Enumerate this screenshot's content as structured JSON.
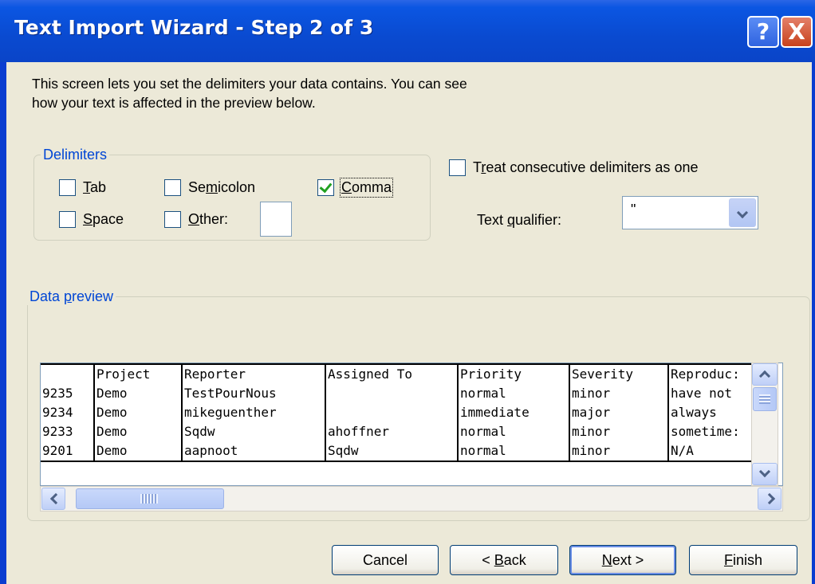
{
  "window": {
    "title": "Text Import Wizard - Step 2 of 3",
    "help_glyph": "?",
    "close_glyph": "X"
  },
  "description": {
    "line1": "This screen lets you set the delimiters your data contains.  You can see",
    "line2": "how your text is affected in the preview below."
  },
  "delimiters": {
    "legend": "Delimiters",
    "tab": {
      "label_pre": "",
      "label_ul": "T",
      "label_post": "ab",
      "checked": false
    },
    "semicolon": {
      "label_pre": "Se",
      "label_ul": "m",
      "label_post": "icolon",
      "checked": false
    },
    "comma": {
      "label_pre": "",
      "label_ul": "C",
      "label_post": "omma",
      "checked": true
    },
    "space": {
      "label_pre": "",
      "label_ul": "S",
      "label_post": "pace",
      "checked": false
    },
    "other": {
      "label_pre": "",
      "label_ul": "O",
      "label_post": "ther:",
      "checked": false,
      "value": ""
    }
  },
  "consecutive": {
    "label_pre": "T",
    "label_ul": "r",
    "label_post": "eat consecutive delimiters as one",
    "checked": false
  },
  "qualifier": {
    "label_pre": "Text ",
    "label_ul": "q",
    "label_post": "ualifier:",
    "value": "\""
  },
  "preview": {
    "legend_pre": "Data ",
    "legend_ul": "p",
    "legend_post": "review",
    "columns": [
      [
        "",
        "9235",
        "9234",
        "9233",
        "9201"
      ],
      [
        "Project",
        "Demo",
        "Demo",
        "Demo",
        "Demo"
      ],
      [
        "Reporter",
        "TestPourNous",
        "mikeguenther",
        "Sqdw",
        "aapnoot"
      ],
      [
        "Assigned To",
        "",
        "",
        "ahoffner",
        "Sqdw"
      ],
      [
        "Priority",
        "normal",
        "immediate",
        "normal",
        "normal"
      ],
      [
        "Severity",
        "minor",
        "major",
        "minor",
        "minor"
      ],
      [
        "Reproduc:",
        "have not",
        "always",
        "sometime:",
        "N/A"
      ]
    ]
  },
  "buttons": {
    "cancel": {
      "pre": "Cancel",
      "ul": "",
      "post": ""
    },
    "back": {
      "pre": "< ",
      "ul": "B",
      "post": "ack"
    },
    "next": {
      "pre": "",
      "ul": "N",
      "post": "ext >"
    },
    "finish": {
      "pre": "",
      "ul": "F",
      "post": "inish"
    }
  },
  "colors": {
    "titlebar": "#0a4ad0",
    "dialog_bg": "#ece9d8",
    "legend": "#0046d5",
    "check": "#21a121"
  }
}
